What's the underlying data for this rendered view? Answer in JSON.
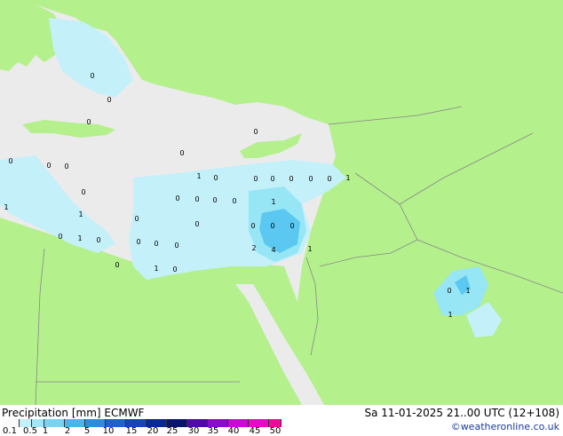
{
  "map": {
    "colors": {
      "land": "#b4f08c",
      "sea": "#ebebeb",
      "border": "#888888",
      "precip_light": "#c4f0fa",
      "precip_mid": "#96e6f5",
      "precip_heavy": "#5ac8f0"
    },
    "value_labels": [
      "0",
      "0",
      "0",
      "0",
      "0",
      "0",
      "0",
      "0",
      "1",
      "0",
      "0",
      "0",
      "0",
      "0",
      "0",
      "1",
      "0",
      "1",
      "0",
      "0",
      "0",
      "0",
      "1",
      "1",
      "0",
      "0",
      "0",
      "0",
      "0",
      "0",
      "1",
      "0",
      "0",
      "0",
      "0",
      "1",
      "2",
      "4",
      "0",
      "1",
      "0",
      "0",
      "1",
      "1",
      "0"
    ]
  },
  "footer": {
    "title_left": "Precipitation [mm]  ECMWF",
    "title_right": "Sa 11-01-2025 21..00 UTC (12+108)",
    "credit": "©weatheronline.co.uk",
    "legend_colors": [
      "#fafafa",
      "#c4f0fa",
      "#a0e6f5",
      "#78d2f0",
      "#4bb4f0",
      "#2d8cdc",
      "#1e64c8",
      "#1446b4",
      "#0a2896",
      "#0a146e",
      "#500aaa",
      "#8c0ac8",
      "#c80ad2",
      "#e60ac8",
      "#f00a96"
    ],
    "legend_ticks": [
      "0.1",
      "0.5",
      "1",
      "2",
      "5",
      "10",
      "15",
      "20",
      "25",
      "30",
      "35",
      "40",
      "45",
      "50"
    ]
  }
}
